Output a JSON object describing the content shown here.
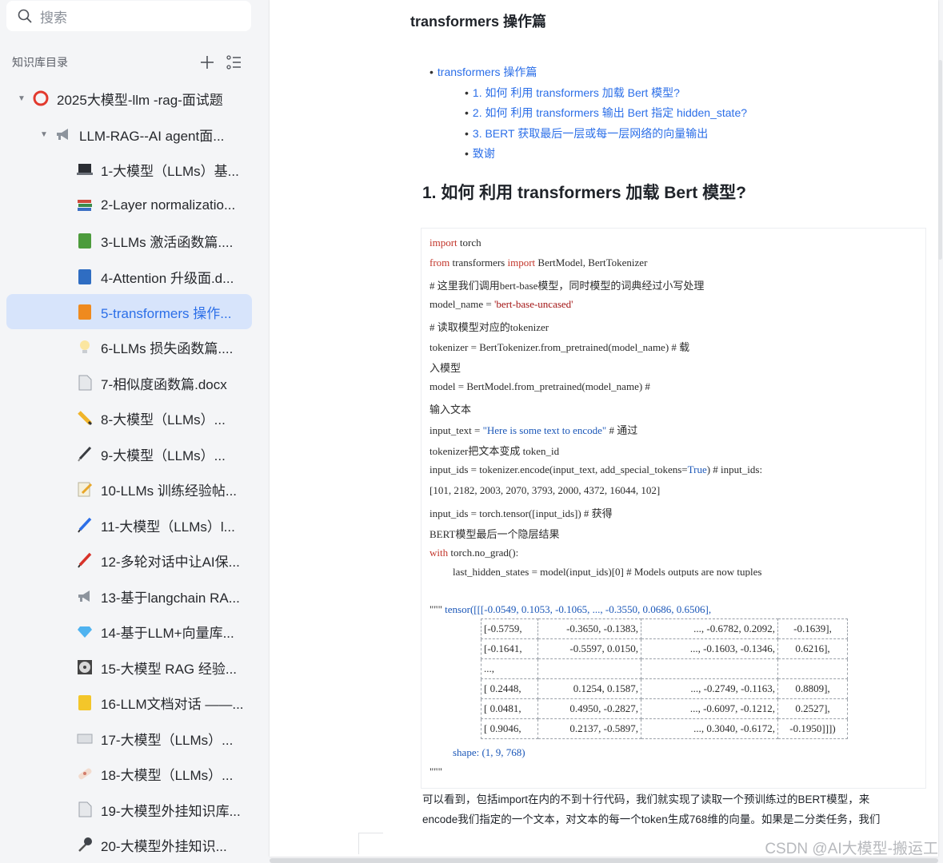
{
  "search": {
    "placeholder": "搜索"
  },
  "kb": {
    "title": "知识库目录"
  },
  "tree": [
    {
      "label": "2025大模型-llm -rag-面试题",
      "icon": "red-ring-icon"
    },
    {
      "label": "LLM-RAG--AI agent面...",
      "icon": "megaphone-icon"
    },
    {
      "label": "1-大模型（LLMs）基...",
      "icon": "laptop-icon"
    },
    {
      "label": "2-Layer normalizatio...",
      "icon": "books-icon"
    },
    {
      "label": "3-LLMs 激活函数篇....",
      "icon": "green-book-icon"
    },
    {
      "label": "4-Attention 升级面.d...",
      "icon": "blue-book-icon"
    },
    {
      "label": "5-transformers 操作...",
      "icon": "orange-book-icon"
    },
    {
      "label": "6-LLMs 损失函数篇....",
      "icon": "lightbulb-icon"
    },
    {
      "label": "7-相似度函数篇.docx",
      "icon": "document-icon"
    },
    {
      "label": "8-大模型（LLMs）...",
      "icon": "pencil-icon"
    },
    {
      "label": "9-大模型（LLMs）...",
      "icon": "pen-icon"
    },
    {
      "label": "10-LLMs 训练经验帖...",
      "icon": "memo-icon"
    },
    {
      "label": "11-大模型（LLMs）l...",
      "icon": "blue-pen-icon"
    },
    {
      "label": "12-多轮对话中让AI保...",
      "icon": "red-pen-icon"
    },
    {
      "label": "13-基于langchain RA...",
      "icon": "megaphone-icon"
    },
    {
      "label": "14-基于LLM+向量库...",
      "icon": "gem-icon"
    },
    {
      "label": "15-大模型 RAG 经验...",
      "icon": "disc-icon"
    },
    {
      "label": "16-LLM文档对话 ——...",
      "icon": "yellow-note-icon"
    },
    {
      "label": "17-大模型（LLMs）...",
      "icon": "keyboard-icon"
    },
    {
      "label": "18-大模型（LLMs）...",
      "icon": "bandage-icon"
    },
    {
      "label": "19-大模型外挂知识库...",
      "icon": "document-icon"
    },
    {
      "label": "20-大模型外挂知识...",
      "icon": "microphone-icon"
    }
  ],
  "doc": {
    "title": "transformers 操作篇",
    "toc": [
      "transformers  操作篇",
      "1. 如何 利用 transformers 加载 Bert 模型?",
      "2. 如何 利用 transformers 输出 Bert 指定 hidden_state?",
      "3.  BERT  获取最后一层或每一层网络的向量输出",
      "致谢"
    ],
    "heading": "1. 如何 利用 transformers 加载 Bert 模型?",
    "code": {
      "l1_kw": "import",
      "l1_rest": " torch",
      "l2_kw1": "from",
      "l2_mid": " transformers ",
      "l2_kw2": "import",
      "l2_rest": " BertModel, BertTokenizer",
      "l3": "# 这里我们调用bert-base模型，同时模型的词典经过小写处理",
      "l4_a": "model_name = ",
      "l4_str": "'bert-base-uncased'",
      "l5": "# 读取模型对应的tokenizer",
      "l6": "tokenizer = BertTokenizer.from_pretrained(model_name)  # 载",
      "l7": "入模型",
      "l8": "model = BertModel.from_pretrained(model_name)  #",
      "l9": "输入文本",
      "l10_a": "input_text = ",
      "l10_str": "\"Here is some text to encode\"",
      "l10_b": "  # 通过",
      "l11": "tokenizer把文本变成 token_id",
      "l12_a": "input_ids = tokenizer.encode(input_text, add_special_tokens=",
      "l12_kw": "True",
      "l12_b": ")  # input_ids:",
      "l13": "[101, 2182, 2003, 2070, 3793, 2000, 4372, 16044, 102]",
      "l14": "input_ids = torch.tensor([input_ids])  # 获得",
      "l15": "BERT模型最后一个隐层结果",
      "l16_kw": "with",
      "l16_rest": " torch.no_grad():",
      "l17": "last_hidden_states = model(input_ids)[0]   # Models outputs are now tuples",
      "l18_a": "\"\"\"",
      "l18_b": " tensor([[[-0.0549,  0.1053, -0.1065,   ..., -0.3550,  0.0686,  0.6506],",
      "shape": "shape: (1, 9, 768)",
      "end": "\"\"\""
    },
    "tensor_rows": [
      [
        "[-0.5759,",
        "-0.3650, -0.1383,",
        "..., -0.6782,  0.2092,",
        "-0.1639],"
      ],
      [
        "[-0.1641,",
        "-0.5597,  0.0150,",
        "..., -0.1603, -0.1346,",
        "0.6216],"
      ],
      [
        "...,",
        "",
        "",
        ""
      ],
      [
        "[ 0.2448,",
        "0.1254,  0.1587,",
        "..., -0.2749, -0.1163,",
        "0.8809],"
      ],
      [
        "[ 0.0481,",
        "0.4950, -0.2827,",
        "..., -0.6097, -0.1212,",
        "0.2527],"
      ],
      [
        "[ 0.9046,",
        "0.2137, -0.5897,",
        "...,  0.3040, -0.6172,",
        "-0.1950]]])"
      ]
    ],
    "para1": "可以看到，包括import在内的不到十行代码，我们就实现了读取一个预训练过的BERT模型，来",
    "para2": "encode我们指定的一个文本，对文本的每一个token生成768维的向量。如果是二分类任务，我们"
  },
  "watermark": "CSDN @AI大模型-搬运工"
}
